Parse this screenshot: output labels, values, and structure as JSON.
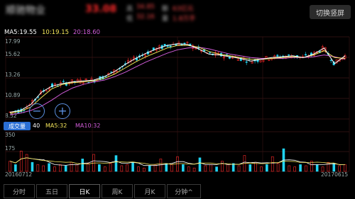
{
  "header": {
    "title": "顺驰物业",
    "price": "33.08",
    "info": [
      "高",
      "34.85",
      "额",
      "63亿元",
      "低",
      "32.16",
      "量",
      "1.8万手"
    ],
    "switch_label": "切换竖屏"
  },
  "ma": {
    "ma5": "MA5:19.55",
    "ma10": "10:19.15",
    "ma20": "20:18.60"
  },
  "price_axis": [
    "17.99",
    "15.62",
    "13.26",
    "10.89",
    "8.52"
  ],
  "vol_axis": [
    "350",
    "175"
  ],
  "volume_legend": {
    "badge": "成交量",
    "value": "40",
    "ma5": "MA5:32",
    "ma10": "MA10:32"
  },
  "dates": {
    "start": "20160712",
    "end": "20170615"
  },
  "zoom": {
    "out": "−",
    "in": "+"
  },
  "tabs": [
    {
      "label": "分时"
    },
    {
      "label": "五日"
    },
    {
      "label": "日K"
    },
    {
      "label": "周K"
    },
    {
      "label": "月K"
    },
    {
      "label": "分钟^"
    }
  ],
  "colors": {
    "up": "#ff2a2a",
    "down": "#21d4f2",
    "ma5": "#ffffff",
    "ma10": "#f3e55a",
    "ma20": "#d05cd8",
    "accent": "#2a6fd4"
  },
  "chart_data": {
    "type": "candlestick",
    "x_range": [
      "20160712",
      "20170615"
    ],
    "y_range": [
      8.52,
      17.99
    ],
    "ma5": [
      9.3,
      9.5,
      10.2,
      11.6,
      12.3,
      12.6,
      12.8,
      12.9,
      13.0,
      13.4,
      14.0,
      14.8,
      15.5,
      16.1,
      16.6,
      17.0,
      17.2,
      17.1,
      16.6,
      16.0,
      15.9,
      15.7,
      15.5,
      15.2,
      15.4,
      15.6,
      15.7,
      15.8,
      15.6,
      16.0,
      16.7,
      14.9,
      15.8
    ],
    "ma10": [
      9.2,
      9.4,
      9.9,
      11.0,
      12.0,
      12.5,
      12.7,
      12.8,
      12.9,
      13.2,
      13.7,
      14.4,
      15.1,
      15.7,
      16.2,
      16.7,
      17.0,
      17.0,
      16.8,
      16.3,
      16.0,
      15.8,
      15.6,
      15.4,
      15.4,
      15.5,
      15.6,
      15.7,
      15.6,
      15.9,
      16.4,
      15.6,
      15.5
    ],
    "ma20": [
      9.0,
      9.2,
      9.5,
      10.0,
      10.7,
      11.5,
      12.1,
      12.5,
      12.8,
      13.0,
      13.4,
      13.9,
      14.5,
      15.1,
      15.6,
      16.1,
      16.5,
      16.7,
      16.8,
      16.6,
      16.3,
      16.0,
      15.8,
      15.6,
      15.5,
      15.5,
      15.5,
      15.6,
      15.6,
      15.7,
      15.9,
      15.7,
      15.4
    ],
    "volume_range": [
      0,
      350
    ],
    "volume": [
      90,
      60,
      180,
      150,
      80,
      60,
      50,
      70,
      40,
      60,
      50,
      80,
      60,
      110,
      70,
      150,
      60,
      40,
      70,
      140,
      50,
      60,
      80,
      40,
      30,
      50,
      60,
      110,
      70,
      60,
      130,
      60,
      40,
      30,
      120,
      50,
      60,
      40,
      90,
      60,
      70,
      50,
      140,
      60,
      80,
      40,
      60,
      130,
      70,
      200,
      50,
      40,
      60,
      50,
      90,
      60,
      40,
      80,
      70,
      50,
      60
    ]
  }
}
